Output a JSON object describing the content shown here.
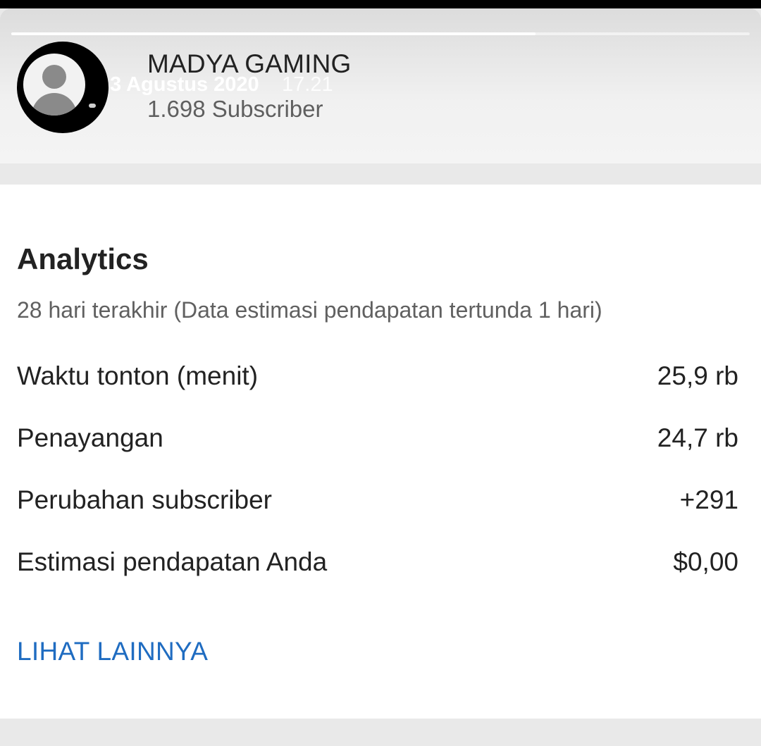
{
  "story": {
    "progress_fraction": 0.71,
    "date": "3 Agustus 2020",
    "time": "17.21"
  },
  "channel": {
    "name": "MADYA GAMING",
    "subscribers": "1.698 Subscriber",
    "avatar_icon": "default-user-avatar-icon"
  },
  "analytics": {
    "title": "Analytics",
    "subtitle": "28 hari terakhir (Data estimasi pendapatan tertunda 1 hari)",
    "metrics": [
      {
        "label": "Waktu tonton (menit)",
        "value": "25,9 rb"
      },
      {
        "label": "Penayangan",
        "value": "24,7 rb"
      },
      {
        "label": "Perubahan subscriber",
        "value": "+291"
      },
      {
        "label": "Estimasi pendapatan Anda",
        "value": "$0,00"
      }
    ],
    "see_more_label": "LIHAT LAINNYA"
  },
  "colors": {
    "link": "#1f6cc1",
    "text": "#222222",
    "muted": "#606060"
  }
}
